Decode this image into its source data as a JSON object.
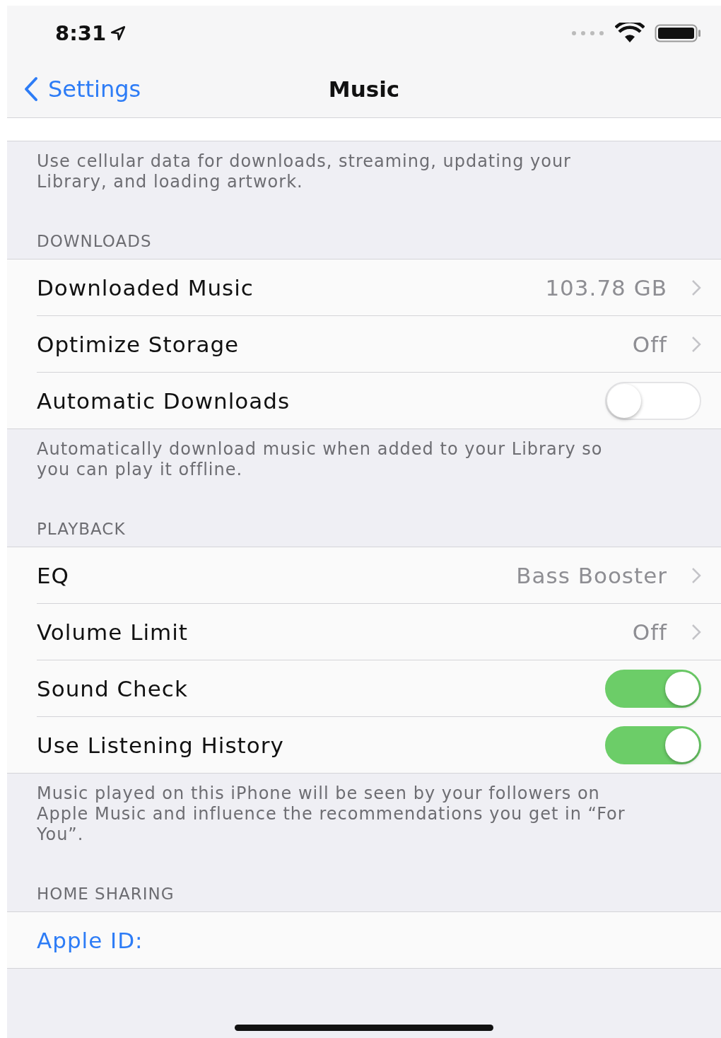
{
  "status_bar": {
    "time": "8:31"
  },
  "nav": {
    "back": "Settings",
    "title": "Music"
  },
  "top_footer": "Use cellular data for downloads, streaming, updating your Library, and loading artwork.",
  "sections": [
    {
      "header": "DOWNLOADS",
      "footer": "Automatically download music when added to your Library so you can play it offline.",
      "rows": [
        {
          "kind": "link",
          "label": "Downloaded Music",
          "value": "103.78 GB"
        },
        {
          "kind": "link",
          "label": "Optimize Storage",
          "value": "Off"
        },
        {
          "kind": "switch",
          "label": "Automatic Downloads",
          "on": false
        }
      ]
    },
    {
      "header": "PLAYBACK",
      "footer": "Music played on this iPhone will be seen by your followers on Apple Music and influence the recommendations you get in “For You”.",
      "rows": [
        {
          "kind": "link",
          "label": "EQ",
          "value": "Bass Booster"
        },
        {
          "kind": "link",
          "label": "Volume Limit",
          "value": "Off"
        },
        {
          "kind": "switch",
          "label": "Sound Check",
          "on": true
        },
        {
          "kind": "switch",
          "label": "Use Listening History",
          "on": true
        }
      ]
    },
    {
      "header": "HOME SHARING",
      "rows": [
        {
          "kind": "account",
          "label": "Apple ID:"
        }
      ]
    }
  ]
}
